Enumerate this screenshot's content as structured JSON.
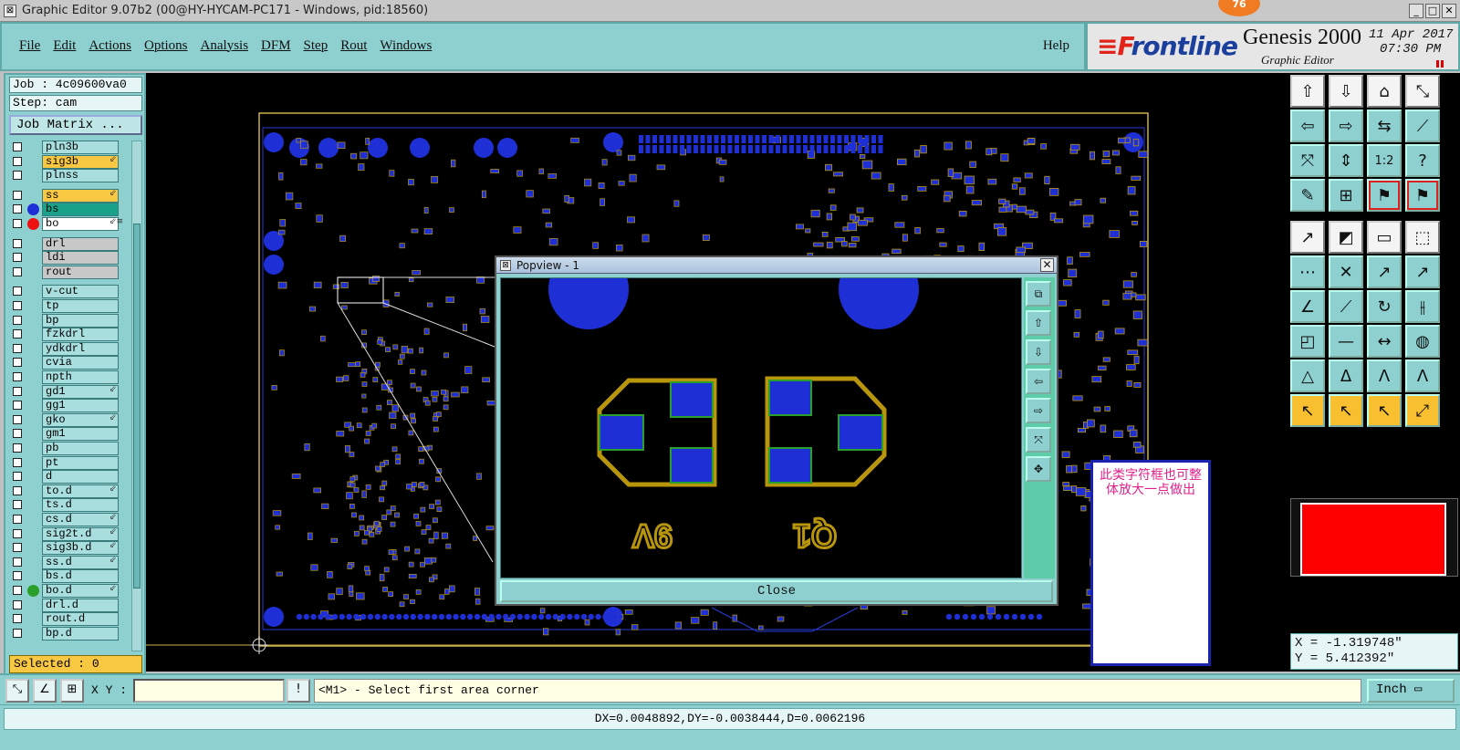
{
  "window": {
    "title": "Graphic Editor 9.07b2 (00@HY-HYCAM-PC171 - Windows, pid:18560)",
    "notification_count": "76"
  },
  "menu": {
    "items": [
      "File",
      "Edit",
      "Actions",
      "Options",
      "Analysis",
      "DFM",
      "Step",
      "Rout",
      "Windows"
    ],
    "help": "Help"
  },
  "brand": {
    "logo_prefix": "F",
    "logo_rest": "rontline",
    "product": "Genesis 2000",
    "subtitle": "Graphic Editor",
    "date": "11 Apr 2017",
    "time": "07:30 PM"
  },
  "left": {
    "job": "Job : 4c09600va0",
    "step": "Step: cam",
    "job_matrix": "Job Matrix ...",
    "selected": "Selected : 0",
    "layers": [
      {
        "name": "pln3b",
        "color": "#a8dede",
        "dot": ""
      },
      {
        "name": "sig3b",
        "color": "#f9c843",
        "dot": "",
        "flag": "⇙"
      },
      {
        "name": "plnss",
        "color": "#a8dede",
        "dot": ""
      },
      {
        "name": "ss",
        "color": "#f9c843",
        "dot": "",
        "flag": "⇙"
      },
      {
        "name": "bs",
        "color": "#1aa38a",
        "dot": "#1f2fd6"
      },
      {
        "name": "bo",
        "color": "#ffffff",
        "dot": "#e11",
        "flag": "⇙≡"
      },
      {
        "name": "drl",
        "color": "#c8c8c8",
        "dot": ""
      },
      {
        "name": "ldi",
        "color": "#c8c8c8",
        "dot": ""
      },
      {
        "name": "rout",
        "color": "#c8c8c8",
        "dot": ""
      },
      {
        "name": "v-cut",
        "color": "#a8dede",
        "dot": ""
      },
      {
        "name": "tp",
        "color": "#a8dede",
        "dot": ""
      },
      {
        "name": "bp",
        "color": "#a8dede",
        "dot": ""
      },
      {
        "name": "fzkdrl",
        "color": "#a8dede",
        "dot": ""
      },
      {
        "name": "ydkdrl",
        "color": "#a8dede",
        "dot": ""
      },
      {
        "name": "cvia",
        "color": "#a8dede",
        "dot": ""
      },
      {
        "name": "npth",
        "color": "#a8dede",
        "dot": ""
      },
      {
        "name": "gd1",
        "color": "#a8dede",
        "dot": "",
        "flag": "⇙"
      },
      {
        "name": "gg1",
        "color": "#a8dede",
        "dot": ""
      },
      {
        "name": "gko",
        "color": "#a8dede",
        "dot": "",
        "flag": "⇙"
      },
      {
        "name": "gm1",
        "color": "#a8dede",
        "dot": ""
      },
      {
        "name": "pb",
        "color": "#a8dede",
        "dot": ""
      },
      {
        "name": "pt",
        "color": "#a8dede",
        "dot": ""
      },
      {
        "name": "d",
        "color": "#a8dede",
        "dot": ""
      },
      {
        "name": "to.d",
        "color": "#a8dede",
        "dot": "",
        "flag": "⇙"
      },
      {
        "name": "ts.d",
        "color": "#a8dede",
        "dot": ""
      },
      {
        "name": "cs.d",
        "color": "#a8dede",
        "dot": "",
        "flag": "⇙"
      },
      {
        "name": "sig2t.d",
        "color": "#a8dede",
        "dot": "",
        "flag": "⇙"
      },
      {
        "name": "sig3b.d",
        "color": "#a8dede",
        "dot": "",
        "flag": "⇙"
      },
      {
        "name": "ss.d",
        "color": "#a8dede",
        "dot": "",
        "flag": "⇙"
      },
      {
        "name": "bs.d",
        "color": "#a8dede",
        "dot": ""
      },
      {
        "name": "bo.d",
        "color": "#a8dede",
        "dot": "#2aa02a",
        "flag": "⇙"
      },
      {
        "name": "drl.d",
        "color": "#a8dede",
        "dot": ""
      },
      {
        "name": "rout.d",
        "color": "#a8dede",
        "dot": ""
      },
      {
        "name": "bp.d",
        "color": "#a8dede",
        "dot": ""
      }
    ]
  },
  "popview": {
    "title": "Popview - 1",
    "close_label": "Close",
    "label_left": "9V",
    "label_right": "Q1"
  },
  "note": {
    "text": "此类字符框也可整体放大一点做出"
  },
  "coords": {
    "x": "X = -1.319748\"",
    "y": "Y = 5.412392\""
  },
  "status": {
    "xy_label": "X Y :",
    "message": "<M1> - Select first area corner",
    "unit": "Inch",
    "measure": "DX=0.0048892,DY=-0.0038444,D=0.0062196"
  },
  "colors": {
    "panel": "#8ed0d0",
    "pad_blue": "#1f2fd6",
    "silk_gold": "#b8960c"
  }
}
